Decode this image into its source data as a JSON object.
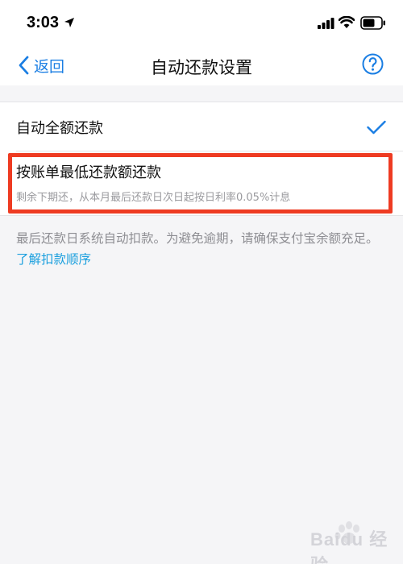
{
  "status_bar": {
    "time": "3:03"
  },
  "nav": {
    "back_label": "返回",
    "title": "自动还款设置",
    "help_icon": "question-circle-icon"
  },
  "options": {
    "full": {
      "label": "自动全额还款",
      "selected": true
    },
    "minimum": {
      "label": "按账单最低还款额还款",
      "description": "剩余下期还，从本月最后还款日次日起按日利率0.05%计息"
    }
  },
  "footer": {
    "note": "最后还款日系统自动扣款。为避免逾期，请确保支付宝余额充足。",
    "link": "了解扣款顺序"
  },
  "watermark": {
    "text": "Baidu 经验"
  },
  "colors": {
    "accent": "#1a7ee3",
    "link": "#1a9fde",
    "highlight": "#ee3b22",
    "background": "#f5f5f7"
  }
}
